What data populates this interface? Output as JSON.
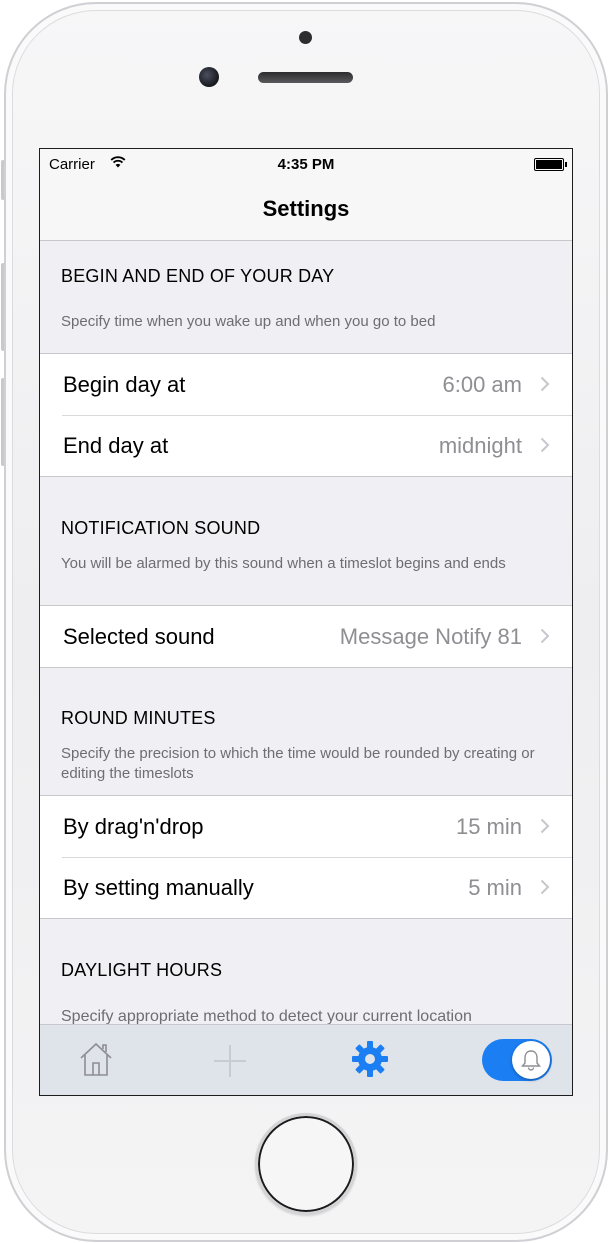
{
  "status_bar": {
    "carrier": "Carrier",
    "time": "4:35 PM"
  },
  "nav": {
    "title": "Settings"
  },
  "sections": [
    {
      "header": "BEGIN AND END OF YOUR DAY",
      "note": "Specify time when you wake up and when you go to bed",
      "rows": [
        {
          "label": "Begin day at",
          "value": "6:00 am"
        },
        {
          "label": "End day at",
          "value": "midnight"
        }
      ]
    },
    {
      "header": "NOTIFICATION SOUND",
      "note": "You will be alarmed by this sound when a timeslot begins and ends",
      "rows": [
        {
          "label": "Selected sound",
          "value": "Message Notify 81"
        }
      ]
    },
    {
      "header": "ROUND MINUTES",
      "note": "Specify the precision to which the time would be rounded by creating or editing the timeslots",
      "rows": [
        {
          "label": "By drag'n'drop",
          "value": "15 min"
        },
        {
          "label": "By setting manually",
          "value": "5 min"
        }
      ]
    },
    {
      "header": "DAYLIGHT HOURS",
      "note": "Specify appropriate method to detect your current location"
    }
  ],
  "tab_bar": {
    "icons": [
      "home-icon",
      "plus-icon",
      "gear-icon",
      "bell-icon"
    ],
    "active": "gear-icon",
    "notifications_toggle_on": true
  },
  "colors": {
    "accent": "#1b7ef2",
    "background": "#efeff4",
    "value_text": "#8e8e93"
  }
}
